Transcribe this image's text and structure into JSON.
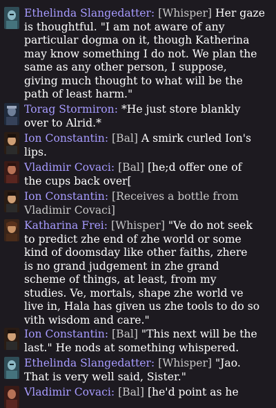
{
  "colors": {
    "background": "#1d1a20",
    "speaker_name": "#a79bff",
    "channel_tag": "#c7c7c7",
    "message_text": "#ffffff"
  },
  "messages": [
    {
      "avatar": "ethelinda-portrait",
      "speaker": "Ethelinda Slangedatter:",
      "channel": "[Whisper]",
      "lines": [
        " Her gaze",
        "is thoughtful. \"I am not aware of any",
        "particular dogma on it, though Katherina",
        "may know something I do not. We plan the",
        "same as any other person, I suppose,",
        "giving much thought to what will be the",
        "path of least harm.\""
      ]
    },
    {
      "avatar": "torag-portrait",
      "speaker": "Torag Stormiron:",
      "channel": "",
      "lines": [
        " *He just store blankly",
        "over to Alrid.*"
      ]
    },
    {
      "avatar": "ion-portrait",
      "speaker": "Ion Constantin:",
      "channel": "[Bal]",
      "lines": [
        " A smirk curled Ion's",
        "lips."
      ]
    },
    {
      "avatar": "vladimir-portrait",
      "speaker": "Vladimir Covaci:",
      "channel": "[Bal]",
      "lines": [
        " [he;d offer one of",
        "the cups back over["
      ]
    },
    {
      "avatar": "ion-portrait",
      "speaker": "Ion Constantin:",
      "channel": "[Receives a bottle from",
      "channel_lines": [
        "Vladimir Covaci]"
      ],
      "lines": []
    },
    {
      "avatar": "katharina-portrait",
      "speaker": "Katharina Frei:",
      "channel": "[Whisper]",
      "lines": [
        " \"Ve do not seek",
        "to predict zhe end of zhe world or some",
        "kind of doomsday like other faiths, zhere",
        "is no grand judgement in zhe grand",
        "scheme of things, at least, from my",
        "studies. Ve, mortals, shape zhe world ve",
        "live in, Hala has given us zhe tools to do so",
        "vith wisdom and care.\""
      ]
    },
    {
      "avatar": "ion-portrait",
      "speaker": "Ion Constantin:",
      "channel": "[Bal]",
      "lines": [
        " \"This next will be the",
        "last.\" He nods at something whispered."
      ]
    },
    {
      "avatar": "ethelinda-portrait",
      "speaker": "Ethelinda Slangedatter:",
      "channel": "[Whisper]",
      "lines": [
        " \"Jao.",
        "That is very well said, Sister.\""
      ]
    },
    {
      "avatar": "vladimir-portrait",
      "speaker": "Vladimir Covaci:",
      "channel": "[Bal]",
      "lines": [
        " [he'd point as he"
      ]
    }
  ]
}
